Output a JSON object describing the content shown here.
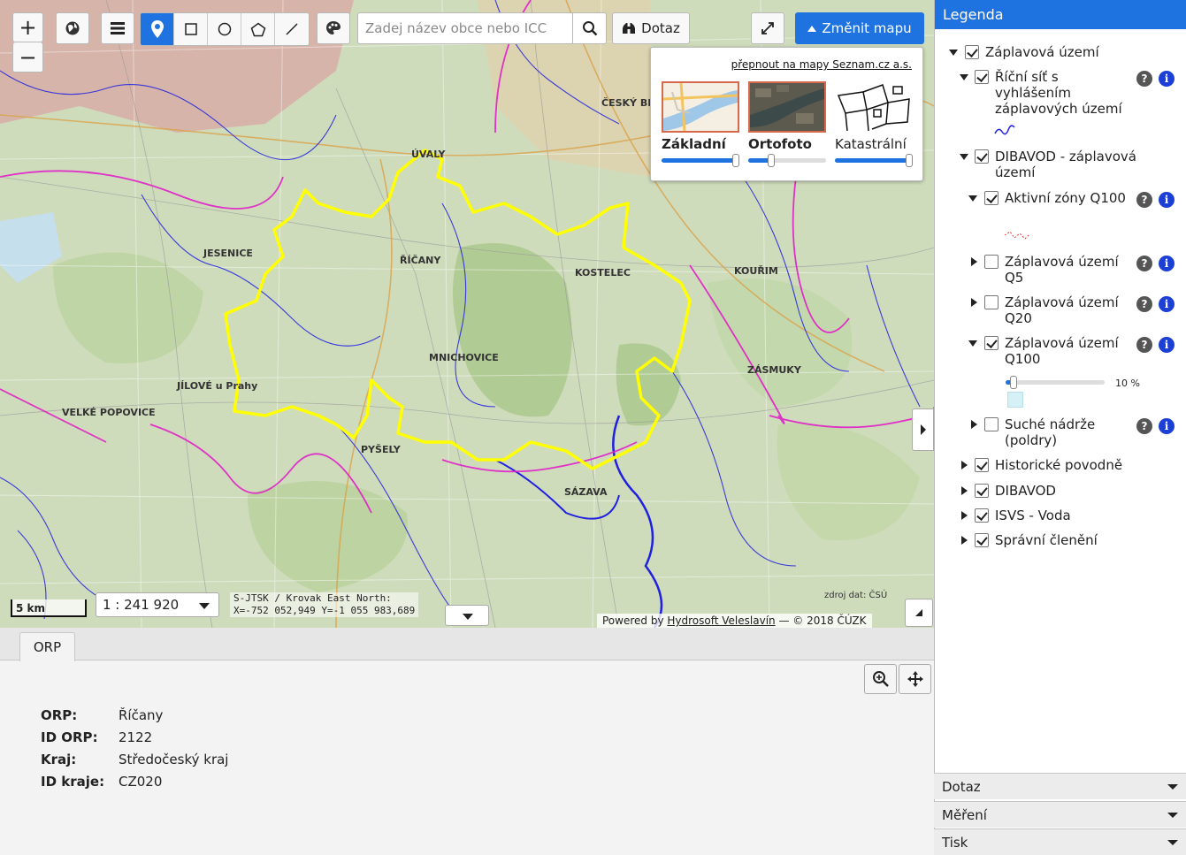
{
  "toolbar": {
    "zoom_in": "+",
    "zoom_out": "−",
    "search_placeholder": "Zadej název obce nebo ICC",
    "query_label": "Dotaz",
    "change_map_label": "Změnit mapu"
  },
  "basemaps": {
    "seznam_link": "přepnout na mapy Seznam.cz a.s.",
    "items": [
      {
        "label": "Základní",
        "opacity": 1.0,
        "active": true
      },
      {
        "label": "Ortofoto",
        "opacity": 0.3,
        "active": true
      },
      {
        "label": "Katastrální",
        "opacity": 1.0,
        "active": false
      }
    ]
  },
  "map": {
    "scale_bar": "5 km",
    "scale_ratio": "1 : 241 920",
    "coords_line1": "S-JTSK / Krovak East North:",
    "coords_line2": "X=-752 052,949 Y=-1 055 983,689",
    "source": "zdroj dat: ČSÚ",
    "attribution_prefix": "Powered by",
    "attribution_link": "Hydrosoft Veleslavín",
    "attribution_suffix": "— © 2018 ČÚZK",
    "place_labels": [
      "JESENICE",
      "ŘÍČANY",
      "KOSTELEC",
      "MNICHOVICE",
      "JÍLOVÉ u Prahy",
      "PYŠELY",
      "SÁZAVA",
      "ZÁSMUKY",
      "KOUŘIM",
      "ÚVALY",
      "ČESKÝ BROD",
      "VELKÉ POPOVICE"
    ]
  },
  "bottom_panel": {
    "tab": "ORP",
    "rows": [
      {
        "key": "ORP",
        "value": "Říčany"
      },
      {
        "key": "ID ORP",
        "value": "2122"
      },
      {
        "key": "Kraj",
        "value": "Středočeský kraj"
      },
      {
        "key": "ID kraje",
        "value": "CZ020"
      }
    ]
  },
  "legend": {
    "title": "Legenda",
    "root": "Záplavová území",
    "items": {
      "ricni_sit": "Říční síť s vyhlášením záplavových území",
      "dibavod_zu": "DIBAVOD - záplavová území",
      "aktivni_zony": "Aktivní zóny Q100",
      "zu_q5": "Záplavová území Q5",
      "zu_q20": "Záplavová území Q20",
      "zu_q100": "Záplavová území Q100",
      "opacity_value": "10 %",
      "suche_nadrze": "Suché nádrže (poldry)",
      "historicke": "Historické povodně",
      "dibavod": "DIBAVOD",
      "isvs": "ISVS - Voda",
      "spravni": "Správní členění"
    },
    "opacity_fraction": 0.1
  },
  "accordion": {
    "dotaz": "Dotaz",
    "mereni": "Měření",
    "tisk": "Tisk"
  },
  "colors": {
    "accent": "#1e73e0",
    "boundary": "#ffff00",
    "rivers": "#1a1adf",
    "admin": "#e020c8"
  }
}
